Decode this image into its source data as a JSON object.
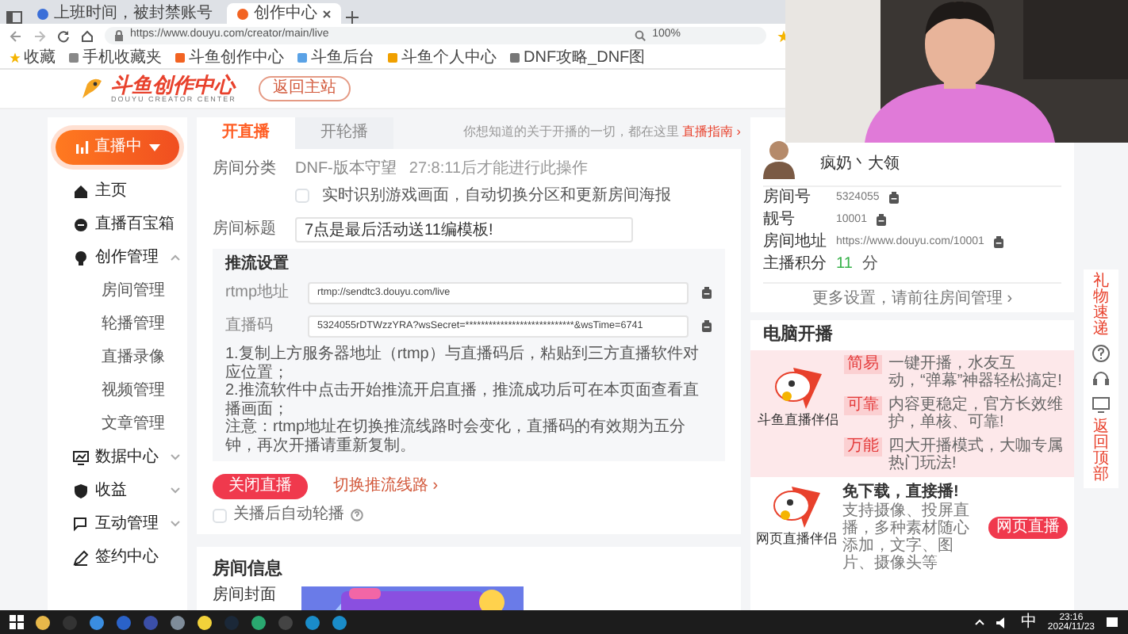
{
  "browser": {
    "tabs": [
      {
        "title": "上班时间，被封禁账号",
        "selected": false
      },
      {
        "title": "创作中心",
        "selected": true
      }
    ],
    "url": "https://www.douyu.com/creator/main/live",
    "zoom": "100%",
    "bookmarks": [
      "收藏",
      "手机收藏夹",
      "斗鱼创作中心",
      "斗鱼后台",
      "斗鱼个人中心",
      "DNF攻略_DNF图"
    ]
  },
  "header": {
    "logo": "斗鱼创作中心",
    "logo_sub": "DOUYU CREATOR CENTER",
    "back_button": "返回主站"
  },
  "sidebar": {
    "live_button": "直播中",
    "items": [
      {
        "label": "主页"
      },
      {
        "label": "直播百宝箱"
      },
      {
        "label": "创作管理",
        "expanded": true,
        "children": [
          {
            "label": "房间管理"
          },
          {
            "label": "轮播管理"
          },
          {
            "label": "直播录像"
          },
          {
            "label": "视频管理"
          },
          {
            "label": "文章管理"
          }
        ]
      },
      {
        "label": "数据中心",
        "expanded": false
      },
      {
        "label": "收益",
        "expanded": false
      },
      {
        "label": "互动管理",
        "expanded": false
      },
      {
        "label": "签约中心"
      }
    ]
  },
  "main": {
    "tabs": [
      {
        "label": "开直播",
        "selected": true
      },
      {
        "label": "开轮播",
        "selected": false
      }
    ],
    "help_text": "你想知道的关于开播的一切，都在这里",
    "help_link": "直播指南 ›",
    "category": {
      "label": "房间分类",
      "value": "DNF-版本守望",
      "note": "27:8:11后才能进行此操作"
    },
    "auto_detect": {
      "label": "实时识别游戏画面，自动切换分区和更新房间海报",
      "checked": false
    },
    "title_field": {
      "label": "房间标题",
      "value": "7点是最后活动送11编模板!"
    },
    "stream": {
      "heading": "推流设置",
      "fields": [
        {
          "label": "rtmp地址",
          "value": "rtmp://sendtc3.douyu.com/live"
        },
        {
          "label": "直播码",
          "value": "5324055rDTWzzYRA?wsSecret=****************************&wsTime=6741"
        }
      ],
      "notes": [
        "1.复制上方服务器地址（rtmp）与直播码后，粘贴到三方直播软件对应位置；",
        "2.推流软件中点击开始推流开启直播，推流成功后可在本页面查看直播画面；",
        "注意：rtmp地址在切换推流线路时会变化，直播码的有效期为五分钟，再次开播请重新复制。"
      ]
    },
    "close_button": "关闭直播",
    "switch_link": "切换推流线路 ›",
    "auto_rotate": {
      "label": "关播后自动轮播",
      "checked": false
    },
    "room_info": {
      "heading": "房间信息",
      "cover_label": "房间封面"
    }
  },
  "profile": {
    "name": "疯奶丶大领",
    "rows": [
      {
        "kind": "copy",
        "label": "房间号",
        "value": "5324055"
      },
      {
        "kind": "copy",
        "label": "靓号",
        "value": "10001"
      },
      {
        "kind": "copy",
        "label": "房间地址",
        "value": "https://www.douyu.com/10001"
      },
      {
        "kind": "score",
        "label": "主播积分",
        "value": "11",
        "unit": "分"
      }
    ],
    "footer": "更多设置，请前往房间管理 ›"
  },
  "pc_live": {
    "heading": "电脑开播",
    "client": {
      "name": "斗鱼直播伴侣",
      "features": [
        {
          "tag": "简易",
          "text": "一键开播，水友互动，“弹幕”神器轻松搞定!"
        },
        {
          "tag": "可靠",
          "text": "内容更稳定，官方长效维护，单核、可靠!"
        },
        {
          "tag": "万能",
          "text": "四大开播模式，大咖专属热门玩法!"
        }
      ]
    },
    "web": {
      "name": "网页直播伴侣",
      "title": "免下载，直接播!",
      "text": "支持摄像、投屏直播，多种素材随心添加，文字、图片、摄像头等",
      "button": "网页直播"
    }
  },
  "float_bar": [
    {
      "kind": "text",
      "label": "礼物速递"
    },
    {
      "kind": "icon"
    },
    {
      "kind": "icon"
    },
    {
      "kind": "icon"
    },
    {
      "kind": "text",
      "label": "返回顶部"
    }
  ],
  "taskbar": {
    "ime": "中",
    "time": "23:16",
    "date": "2024/11/23"
  }
}
